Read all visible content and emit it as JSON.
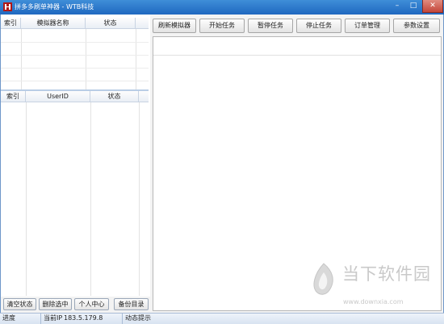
{
  "window": {
    "title": "拼多多刷单神器 - WTB科技",
    "minimize_icon": "minimize-icon",
    "maximize_icon": "maximize-icon",
    "close_icon": "close-icon"
  },
  "emulator_grid": {
    "columns": [
      "索引",
      "模拟器名称",
      "状态"
    ],
    "rows": []
  },
  "user_grid": {
    "columns": [
      "索引",
      "UserID",
      "状态"
    ],
    "rows": []
  },
  "left_buttons": [
    "清空状态",
    "删除选中",
    "个人中心",
    "备份目录"
  ],
  "toolbar": {
    "buttons": [
      "刷新模拟器",
      "开始任务",
      "暂停任务",
      "停止任务",
      "订单管理",
      "参数设置"
    ]
  },
  "log": {
    "content": ""
  },
  "statusbar": {
    "progress_label": "进度",
    "ip_label": "当前IP",
    "ip_value": "183.5.179.8",
    "hint_label": "动态提示"
  },
  "watermark": {
    "brand": "当下软件园",
    "url": "www.downxia.com"
  },
  "colors": {
    "titlebar": "#2f7ccf",
    "panel_bg": "#ffffff",
    "window_bg": "#f3f3f3"
  }
}
